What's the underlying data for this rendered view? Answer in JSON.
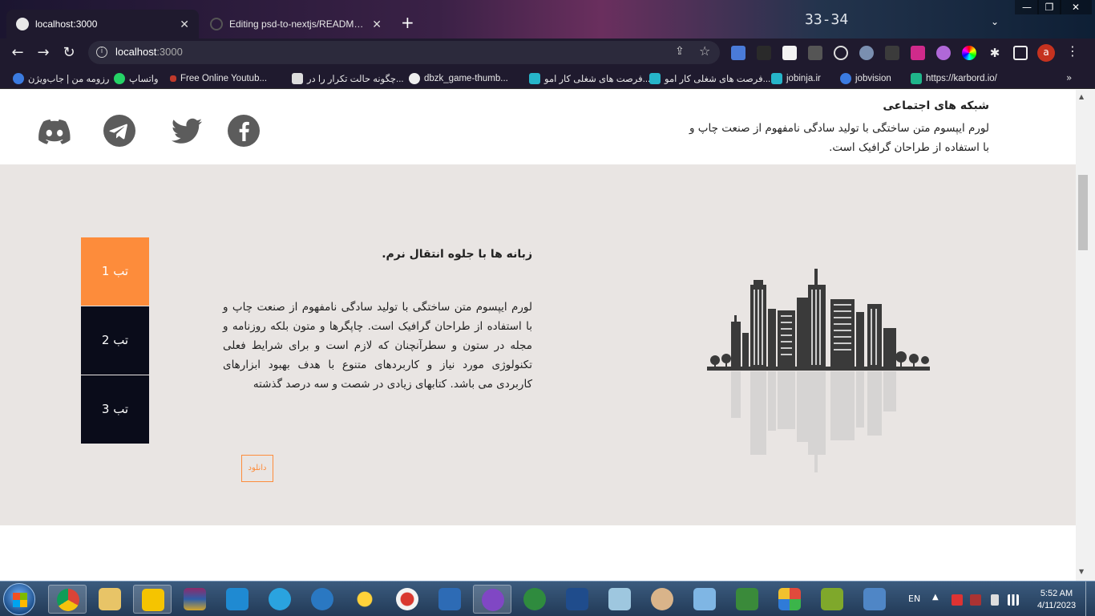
{
  "browser": {
    "tabs": [
      {
        "title": "localhost:3000",
        "active": true
      },
      {
        "title": "Editing psd-to-nextjs/README.m",
        "active": false
      }
    ],
    "new_tab": "+",
    "wallpaper_text": "33-34",
    "address": {
      "host": "localhost",
      "port": ":3000"
    },
    "profile_initial": "a",
    "bookmarks": [
      {
        "label": "رزومه من | جاب‌ویژن",
        "icon": "jobvision-icon"
      },
      {
        "label": "واتساپ",
        "icon": "whatsapp-icon"
      },
      {
        "label": "Free Online Youtub...",
        "icon": "youtube-icon"
      },
      {
        "label": "چگونه حالت تکرار را در...",
        "icon": "doc-icon"
      },
      {
        "label": "dbzk_game-thumb...",
        "icon": "globe-icon"
      },
      {
        "label": "فرصت های شغلی کار امو...",
        "icon": "jobinja-icon"
      },
      {
        "label": "فرصت های شغلی کار امو...",
        "icon": "jobinja-icon"
      },
      {
        "label": "jobinja.ir",
        "icon": "jobinja-icon"
      },
      {
        "label": "jobvision",
        "icon": "jobvision-icon"
      },
      {
        "label": "https://karbord.io/",
        "icon": "karbord-icon"
      }
    ],
    "bookmarks_more": "»"
  },
  "page": {
    "social": {
      "heading": "شبکه های اجتماعی",
      "description": "لورم ایپسوم متن ساختگی با تولید سادگی نامفهوم از صنعت چاپ و با استفاده از طراحان گرافیک است.",
      "icons": [
        "facebook-icon",
        "twitter-icon",
        "telegram-icon",
        "discord-icon"
      ]
    },
    "tabs_section": {
      "tabs": [
        "تب 1",
        "تب 2",
        "تب 3"
      ],
      "active_tab": 0,
      "title": "زبانه ها با جلوه انتقال نرم.",
      "body": "لورم ایپسوم متن ساختگی با تولید سادگی نامفهوم از صنعت چاپ و با استفاده از طراحان گرافیک است. چاپگرها و متون بلکه روزنامه و مجله در ستون و سطرآنچنان که لازم است و برای شرایط فعلی تکنولوژی مورد نیاز و کاربردهای متنوع با هدف بهبود ابزارهای کاربردی می باشد. کتابهای زیادی در شصت و سه درصد گذشته",
      "download_label": "دانلود",
      "accent_color": "#fd8c3b",
      "dark_color": "#0a0c1a"
    }
  },
  "taskbar": {
    "language": "EN",
    "time": "5:52 AM",
    "date": "4/11/2023",
    "apps": [
      "chrome-icon",
      "file-explorer-icon",
      "player-icon",
      "winrar-icon",
      "vscode-icon",
      "telegram-icon",
      "veracrypt-icon",
      "weather-icon",
      "screen-recorder-icon",
      "sc-icon",
      "github-desktop-icon",
      "network-icon",
      "virtualbox-icon",
      "notes-icon",
      "paint-icon",
      "box-icon",
      "android-icon",
      "git-icon",
      "lambda-icon",
      "remote-desktop-icon"
    ]
  }
}
